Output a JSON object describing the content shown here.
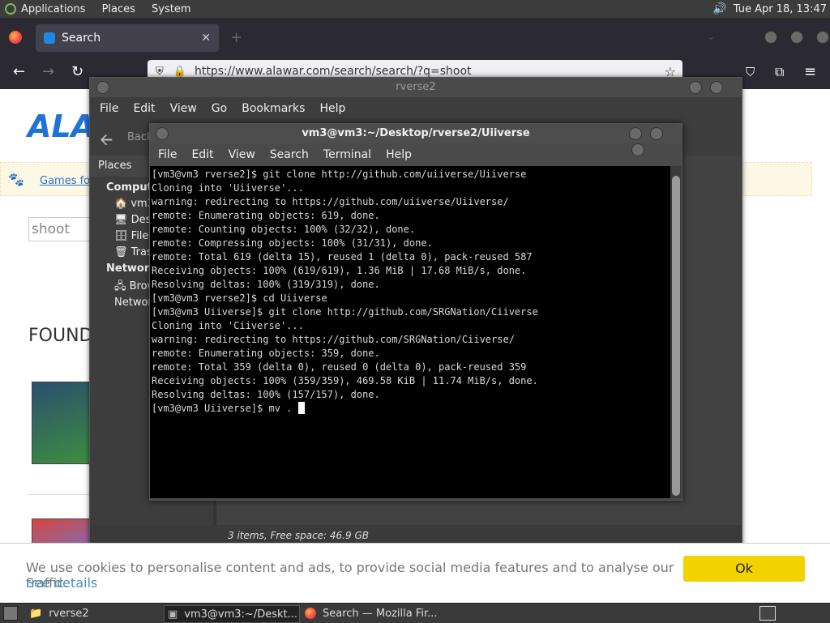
{
  "top_panel": {
    "menus": [
      "Applications",
      "Places",
      "System"
    ],
    "clock": "Tue Apr 18, 13:47"
  },
  "firefox": {
    "tab_title": "Search",
    "url": "https://www.alawar.com/search/search/?q=shoot",
    "page": {
      "logo": "ALA",
      "nav_link": "Games for",
      "search_value": "shoot",
      "found_heading": "FOUND"
    }
  },
  "file_manager": {
    "title": "rverse2",
    "menus": [
      "File",
      "Edit",
      "View",
      "Go",
      "Bookmarks",
      "Help"
    ],
    "back_label": "Back",
    "sidebar_header": "Places",
    "sidebar": {
      "computer_header": "Computer",
      "computer_items": [
        "vm3",
        "Desktop",
        "File System",
        "Trash"
      ],
      "network_header": "Network",
      "network_items": [
        "Browse Network"
      ]
    },
    "status": "3 items, Free space: 46.9 GB"
  },
  "terminal": {
    "title": "vm3@vm3:~/Desktop/rverse2/Uiiverse",
    "menus": [
      "File",
      "Edit",
      "View",
      "Search",
      "Terminal",
      "Help"
    ],
    "lines": [
      "[vm3@vm3 rverse2]$ git clone http://github.com/uiiverse/Uiiverse",
      "Cloning into 'Uiiverse'...",
      "warning: redirecting to https://github.com/uiiverse/Uiiverse/",
      "remote: Enumerating objects: 619, done.",
      "remote: Counting objects: 100% (32/32), done.",
      "remote: Compressing objects: 100% (31/31), done.",
      "remote: Total 619 (delta 15), reused 1 (delta 0), pack-reused 587",
      "Receiving objects: 100% (619/619), 1.36 MiB | 17.68 MiB/s, done.",
      "Resolving deltas: 100% (319/319), done.",
      "[vm3@vm3 rverse2]$ cd Uiiverse",
      "[vm3@vm3 Uiiverse]$ git clone http://github.com/SRGNation/Ciiverse",
      "Cloning into 'Ciiverse'...",
      "warning: redirecting to https://github.com/SRGNation/Ciiverse/",
      "remote: Enumerating objects: 359, done.",
      "remote: Total 359 (delta 0), reused 0 (delta 0), pack-reused 359",
      "Receiving objects: 100% (359/359), 469.58 KiB | 11.74 MiB/s, done.",
      "Resolving deltas: 100% (157/157), done."
    ],
    "prompt_line": "[vm3@vm3 Uiiverse]$ mv . "
  },
  "cookie_bar": {
    "text": "We use cookies to personalise content and ads, to provide social media features and to analyse our traffic.",
    "link": "See details",
    "ok": "Ok"
  },
  "taskbar": {
    "items": [
      "rverse2",
      "vm3@vm3:~/Deskt...",
      "Search — Mozilla Fir..."
    ]
  }
}
